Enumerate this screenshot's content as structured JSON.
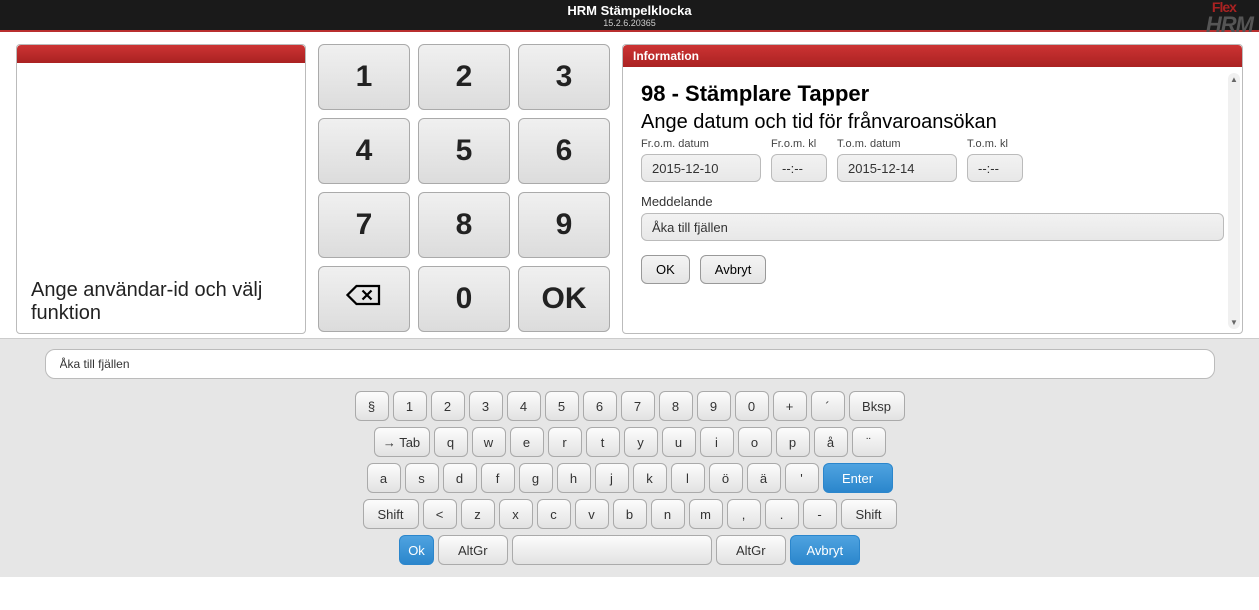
{
  "header": {
    "title": "HRM Stämpelklocka",
    "version": "15.2.6.20365",
    "logo_top": "Flex",
    "logo_bottom": "HRM"
  },
  "left": {
    "prompt": "Ange användar-id och välj funktion"
  },
  "keypad": {
    "k1": "1",
    "k2": "2",
    "k3": "3",
    "k4": "4",
    "k5": "5",
    "k6": "6",
    "k7": "7",
    "k8": "8",
    "k9": "9",
    "k0": "0",
    "ok": "OK"
  },
  "info": {
    "panel_title": "Information",
    "user": "98 - Stämplare Tapper",
    "instruction": "Ange datum och tid för frånvaroansökan",
    "labels": {
      "from_date": "Fr.o.m. datum",
      "from_time": "Fr.o.m. kl",
      "to_date": "T.o.m. datum",
      "to_time": "T.o.m. kl",
      "message": "Meddelande"
    },
    "values": {
      "from_date": "2015-12-10",
      "from_time": "--:--",
      "to_date": "2015-12-14",
      "to_time": "--:--",
      "message": "Åka till fjällen"
    },
    "buttons": {
      "ok": "OK",
      "cancel": "Avbryt"
    }
  },
  "kb": {
    "input_value": "Åka till fjällen",
    "row1": [
      "§",
      "1",
      "2",
      "3",
      "4",
      "5",
      "6",
      "7",
      "8",
      "9",
      "0",
      "+",
      "´",
      "Bksp"
    ],
    "row2": [
      "→ Tab",
      "q",
      "w",
      "e",
      "r",
      "t",
      "y",
      "u",
      "i",
      "o",
      "p",
      "å",
      "¨"
    ],
    "row3": [
      "a",
      "s",
      "d",
      "f",
      "g",
      "h",
      "j",
      "k",
      "l",
      "ö",
      "ä",
      "'",
      "Enter"
    ],
    "row4": [
      "Shift",
      "<",
      "z",
      "x",
      "c",
      "v",
      "b",
      "n",
      "m",
      ",",
      ".",
      "-",
      "Shift"
    ],
    "row5": {
      "ok": "Ok",
      "altgr_l": "AltGr",
      "altgr_r": "AltGr",
      "cancel": "Avbryt"
    }
  }
}
